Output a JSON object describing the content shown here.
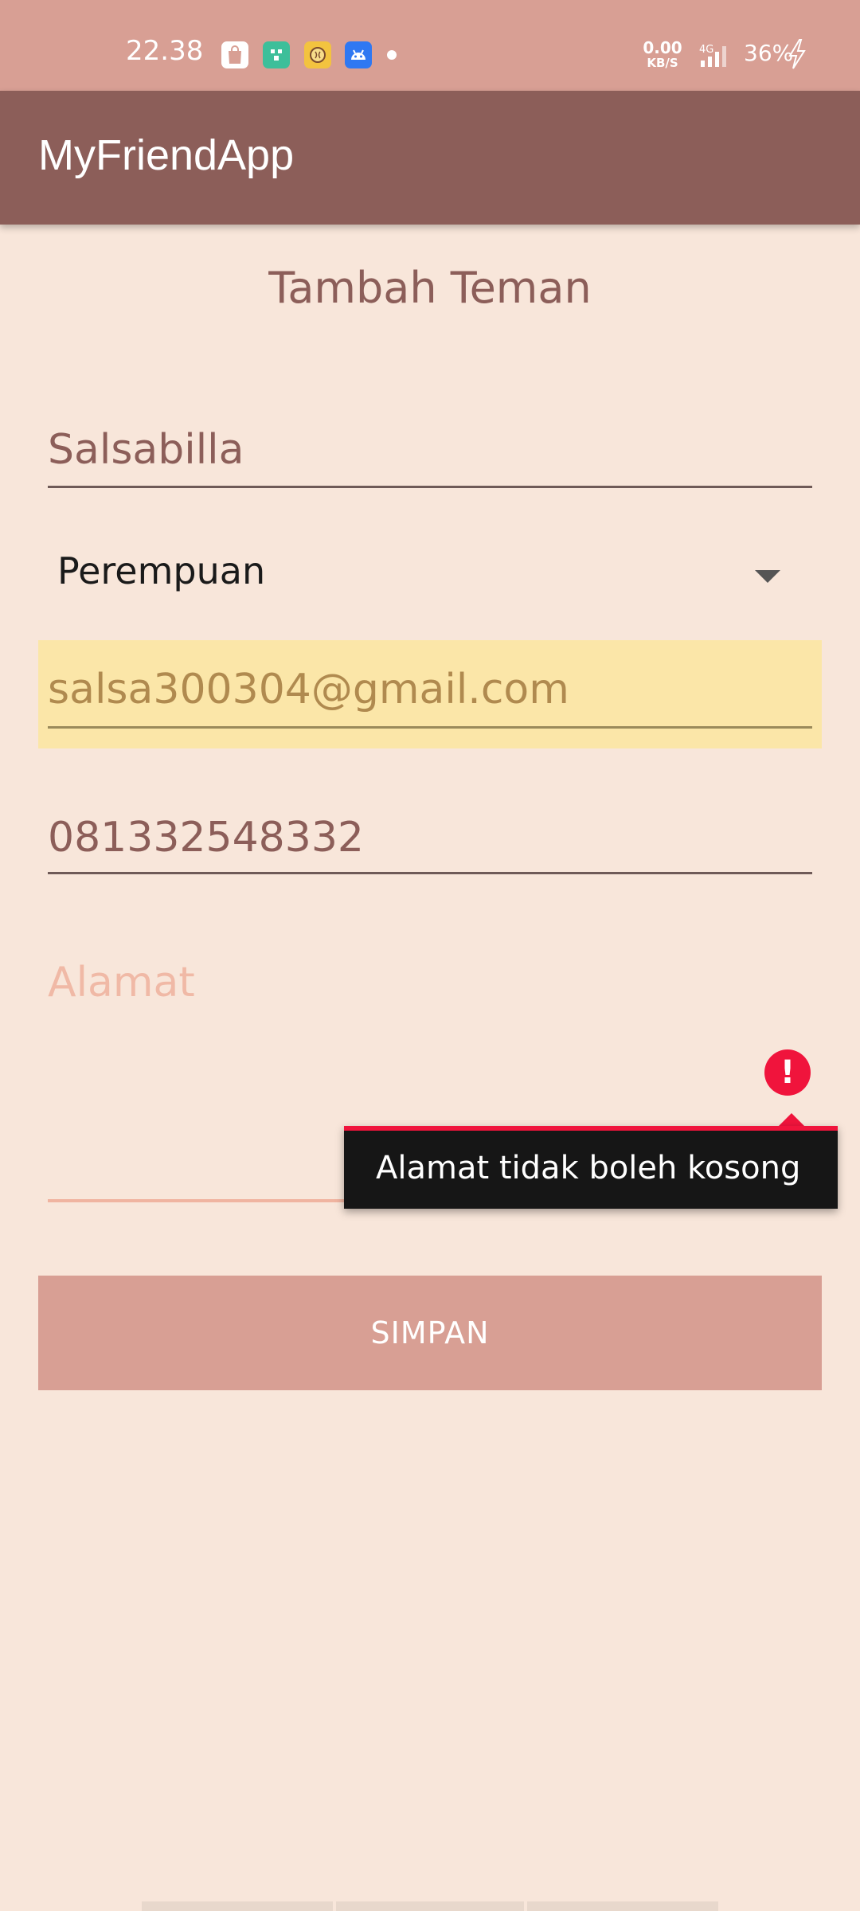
{
  "status_bar": {
    "time": "22.38",
    "net_speed_value": "0.00",
    "net_speed_unit": "KB/S",
    "network_type": "4G",
    "battery": "36%",
    "notification_icons": [
      "shopping-bag-icon",
      "green-app-icon",
      "brain-app-icon",
      "android-icon"
    ]
  },
  "app_bar": {
    "title": "MyFriendApp"
  },
  "form": {
    "heading": "Tambah Teman",
    "name_value": "Salsabilla",
    "gender_selected": "Perempuan",
    "email_value": "salsa300304@gmail.com",
    "phone_value": "081332548332",
    "address_hint": "Alamat",
    "address_error": "Alamat tidak boleh kosong",
    "save_label": "SIMPAN"
  },
  "colors": {
    "status_bar": "#d89f94",
    "app_bar": "#8c5e59",
    "background": "#f8e6da",
    "accent": "#d89f94",
    "error": "#f0143c"
  }
}
